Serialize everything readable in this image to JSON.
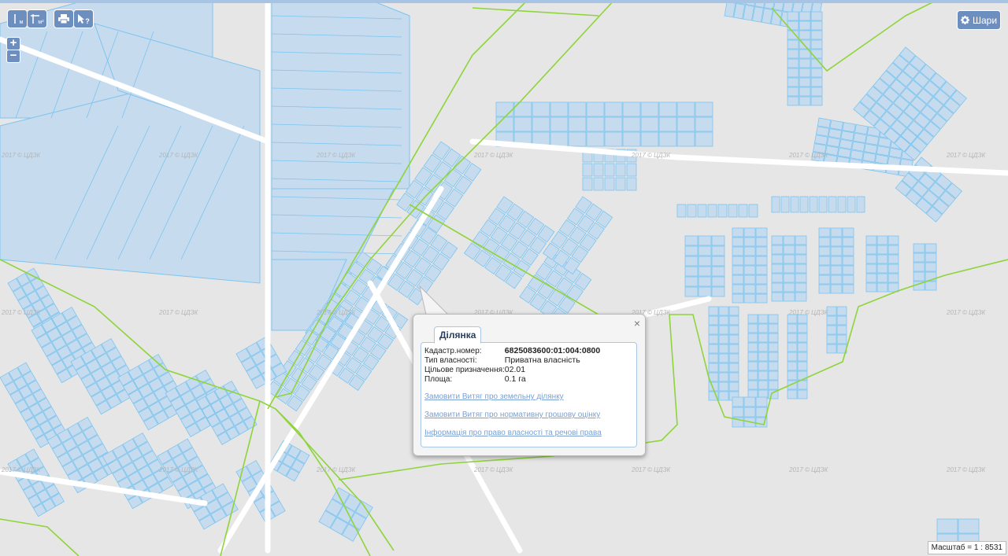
{
  "toolbar": {
    "measure_length_label": "м",
    "measure_area_label": "м²",
    "print_icon": "print-icon",
    "identify_label": "?"
  },
  "zoom": {
    "in_label": "+",
    "out_label": "−"
  },
  "layers_button": {
    "label": "Шари",
    "icon": "gear-icon"
  },
  "map": {
    "watermark": "2017 © ЦДЗК",
    "colors": {
      "background": "#e6e6e6",
      "parcel_fill": "#c7dbee",
      "parcel_stroke": "#7cc4ee",
      "boundary": "#8ed43a",
      "road": "#ffffff"
    }
  },
  "popup": {
    "tab_label": "Ділянка",
    "rows": [
      {
        "label": "Кадастр.номер:",
        "value": "6825083600:01:004:0800"
      },
      {
        "label": "Тип власності:",
        "value": "Приватна власність"
      },
      {
        "label": "Цільове призначення:",
        "value": "02.01"
      },
      {
        "label": "Площа:",
        "value": "0.1 га"
      }
    ],
    "links": [
      "Замовити Витяг про земельну ділянку",
      "Замовити Витяг про нормативну грошову оцінку",
      "Інформація про право власності та речові права"
    ],
    "close_label": "×"
  },
  "scale": {
    "label": "Масштаб = 1 : 8531"
  }
}
